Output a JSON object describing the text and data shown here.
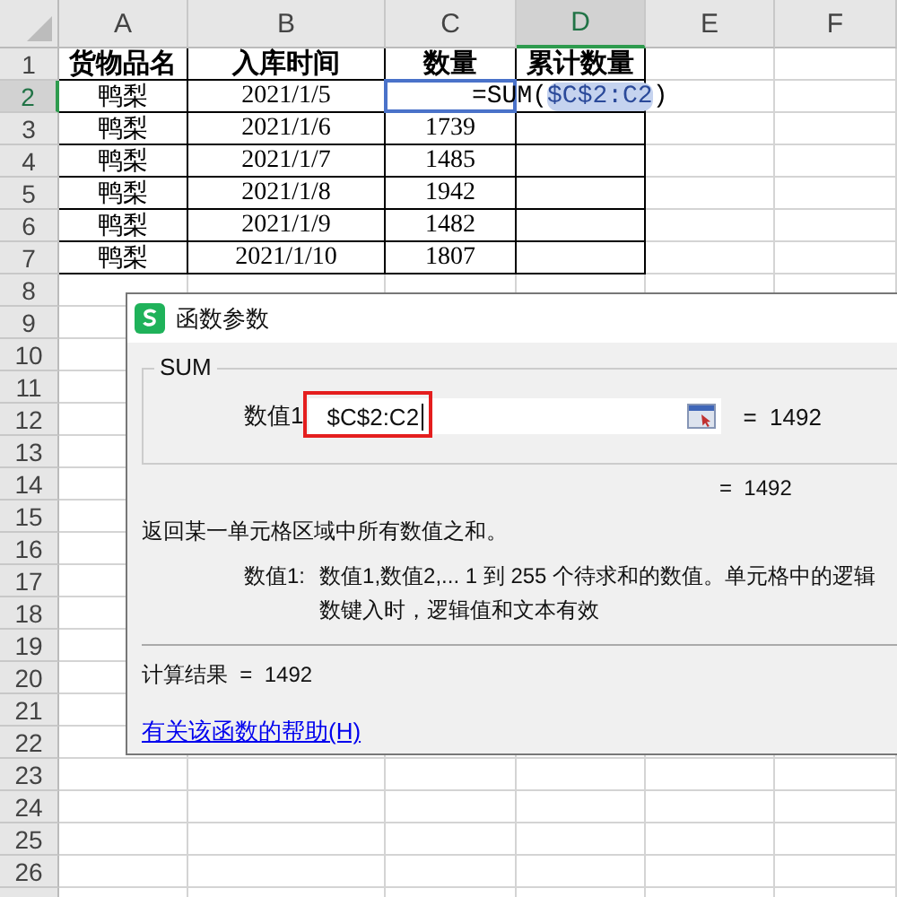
{
  "columns": [
    {
      "label": "A",
      "selected": false
    },
    {
      "label": "B",
      "selected": false
    },
    {
      "label": "C",
      "selected": false
    },
    {
      "label": "D",
      "selected": true
    },
    {
      "label": "E",
      "selected": false
    },
    {
      "label": "F",
      "selected": false
    }
  ],
  "rows": [
    {
      "number": "1",
      "selected": false,
      "kind": "header",
      "cells": [
        {
          "kind": "text",
          "text": "货物品名"
        },
        {
          "kind": "text",
          "text": "入库时间"
        },
        {
          "kind": "text",
          "text": "数量"
        },
        {
          "kind": "text",
          "text": "累计数量"
        }
      ]
    },
    {
      "number": "2",
      "selected": true,
      "kind": "data",
      "cells": [
        {
          "kind": "text",
          "text": "鸭梨"
        },
        {
          "kind": "text",
          "text": "2021/1/5"
        },
        {
          "kind": "formula",
          "prefix": "=SUM(",
          "reference": "$C$2:C2",
          "suffix": ")"
        },
        {
          "kind": "empty"
        }
      ]
    },
    {
      "number": "3",
      "selected": false,
      "kind": "data",
      "cells": [
        {
          "kind": "text",
          "text": "鸭梨"
        },
        {
          "kind": "text",
          "text": "2021/1/6"
        },
        {
          "kind": "text",
          "text": "1739"
        },
        {
          "kind": "empty"
        }
      ]
    },
    {
      "number": "4",
      "selected": false,
      "kind": "data",
      "cells": [
        {
          "kind": "text",
          "text": "鸭梨"
        },
        {
          "kind": "text",
          "text": "2021/1/7"
        },
        {
          "kind": "text",
          "text": "1485"
        },
        {
          "kind": "empty"
        }
      ]
    },
    {
      "number": "5",
      "selected": false,
      "kind": "data",
      "cells": [
        {
          "kind": "text",
          "text": "鸭梨"
        },
        {
          "kind": "text",
          "text": "2021/1/8"
        },
        {
          "kind": "text",
          "text": "1942"
        },
        {
          "kind": "empty"
        }
      ]
    },
    {
      "number": "6",
      "selected": false,
      "kind": "data",
      "cells": [
        {
          "kind": "text",
          "text": "鸭梨"
        },
        {
          "kind": "text",
          "text": "2021/1/9"
        },
        {
          "kind": "text",
          "text": "1482"
        },
        {
          "kind": "empty"
        }
      ]
    },
    {
      "number": "7",
      "selected": false,
      "kind": "data",
      "cells": [
        {
          "kind": "text",
          "text": "鸭梨"
        },
        {
          "kind": "text",
          "text": "2021/1/10"
        },
        {
          "kind": "text",
          "text": "1807"
        },
        {
          "kind": "empty"
        }
      ]
    },
    {
      "number": "8",
      "selected": false,
      "kind": "blank"
    },
    {
      "number": "9",
      "selected": false,
      "kind": "blank"
    },
    {
      "number": "10",
      "selected": false,
      "kind": "blank"
    },
    {
      "number": "11",
      "selected": false,
      "kind": "blank"
    },
    {
      "number": "12",
      "selected": false,
      "kind": "blank"
    },
    {
      "number": "13",
      "selected": false,
      "kind": "blank"
    },
    {
      "number": "14",
      "selected": false,
      "kind": "blank"
    },
    {
      "number": "15",
      "selected": false,
      "kind": "blank"
    },
    {
      "number": "16",
      "selected": false,
      "kind": "blank"
    },
    {
      "number": "17",
      "selected": false,
      "kind": "blank"
    },
    {
      "number": "18",
      "selected": false,
      "kind": "blank"
    },
    {
      "number": "19",
      "selected": false,
      "kind": "blank"
    },
    {
      "number": "20",
      "selected": false,
      "kind": "blank"
    },
    {
      "number": "21",
      "selected": false,
      "kind": "blank"
    },
    {
      "number": "22",
      "selected": false,
      "kind": "blank"
    },
    {
      "number": "23",
      "selected": false,
      "kind": "blank"
    },
    {
      "number": "24",
      "selected": false,
      "kind": "blank"
    },
    {
      "number": "25",
      "selected": false,
      "kind": "blank"
    },
    {
      "number": "26",
      "selected": false,
      "kind": "blank"
    }
  ],
  "dialog": {
    "title": "函数参数",
    "group_label": "SUM",
    "argument": {
      "label": "数值1",
      "value": "$C$2:C2",
      "annotated": true,
      "result": "=  1492"
    },
    "formula_result": "=  1492",
    "description": "返回某一单元格区域中所有数值之和。",
    "argument_help": {
      "label": "数值1:",
      "lines": [
        "数值1,数值2,... 1 到 255 个待求和的数值。单元格中的逻辑",
        "数键入时，逻辑值和文本有效"
      ]
    },
    "calc_result": "计算结果  =  1492",
    "help_link": "有关该函数的帮助(H)"
  }
}
